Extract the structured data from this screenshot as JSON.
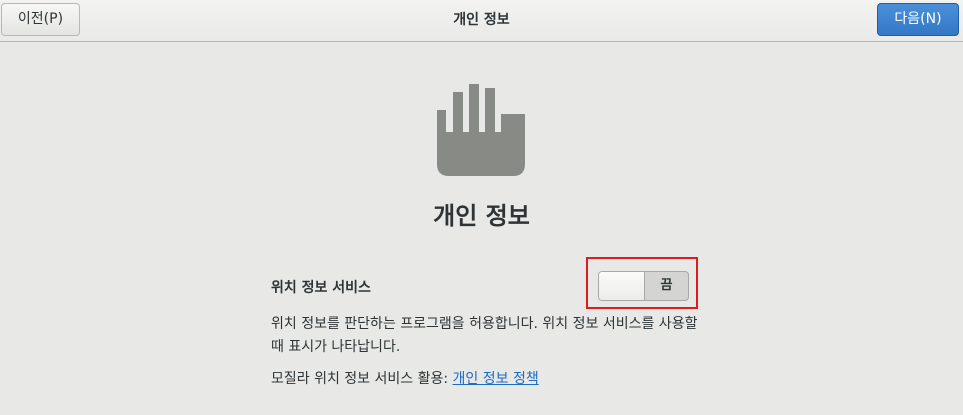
{
  "header": {
    "prev_label": "이전(P)",
    "title": "개인 정보",
    "next_label": "다음(N)"
  },
  "main": {
    "icon": "hand-stop-icon",
    "title": "개인 정보",
    "location": {
      "label": "위치 정보 서비스",
      "toggle_state": "끔",
      "enabled": false,
      "description": "위치 정보를 판단하는 프로그램을 허용합니다. 위치 정보 서비스를 사용할 때 표시가 나타납니다.",
      "mozilla_prefix": "모질라 위치 정보 서비스 활용: ",
      "policy_link": "개인 정보 정책"
    }
  },
  "colors": {
    "accent": "#3478c5",
    "highlight": "#e01b1b",
    "link": "#1c6cc4",
    "icon": "#888a85"
  }
}
